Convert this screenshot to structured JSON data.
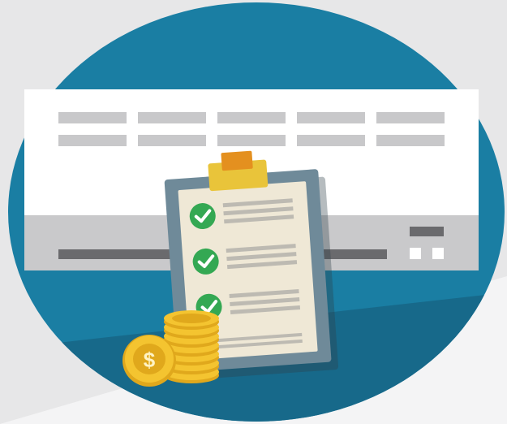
{
  "illustration": {
    "background": {
      "color": "#e7e7e8",
      "shadow_color": "#f4f4f5"
    },
    "circle": {
      "color": "#1a7ea3",
      "dark_color": "#17698a"
    },
    "document": {
      "header_color": "#ffffff",
      "footer_color": "#c9c9cb",
      "placeholder_line_color": "#c8c8ca",
      "dark_bar_color": "#6a6a6d",
      "placeholder_rows": 2,
      "placeholder_columns": 5
    },
    "clipboard": {
      "board_color": "#6f8a99",
      "paper_color": "#efe8d6",
      "clip_color": "#e9c43a",
      "clip_tab_color": "#e4901f",
      "line_color": "#bdbab2",
      "checklist": [
        {
          "status": "checked",
          "icon": "check-circle-icon",
          "color": "#34a853"
        },
        {
          "status": "checked",
          "icon": "check-circle-icon",
          "color": "#34a853"
        },
        {
          "status": "checked",
          "icon": "check-circle-icon",
          "color": "#34a853"
        }
      ]
    },
    "coins": {
      "coin_color": "#f4c430",
      "coin_edge_color": "#e0a81c",
      "symbol": "$",
      "stack_count": 7
    }
  }
}
